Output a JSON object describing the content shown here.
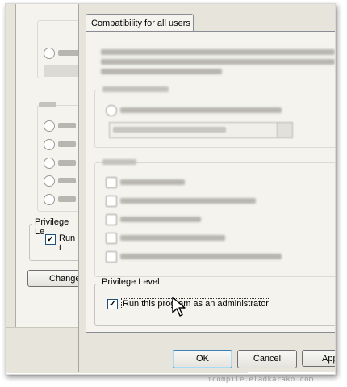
{
  "front_dialog": {
    "tab_label": "Compatibility for all users",
    "privilege_group_label": "Privilege Level",
    "run_as_admin_label": "Run this program as an administrator",
    "run_as_admin_checked": "✓",
    "ok_label": "OK",
    "cancel_label": "Cancel",
    "apply_label": "App"
  },
  "back_dialog": {
    "privilege_group_label": "Privilege Le",
    "run_label": "Run t",
    "run_checked": "✓",
    "change_button_label": "Change"
  },
  "watermark": "icompile.eladkarako.com"
}
